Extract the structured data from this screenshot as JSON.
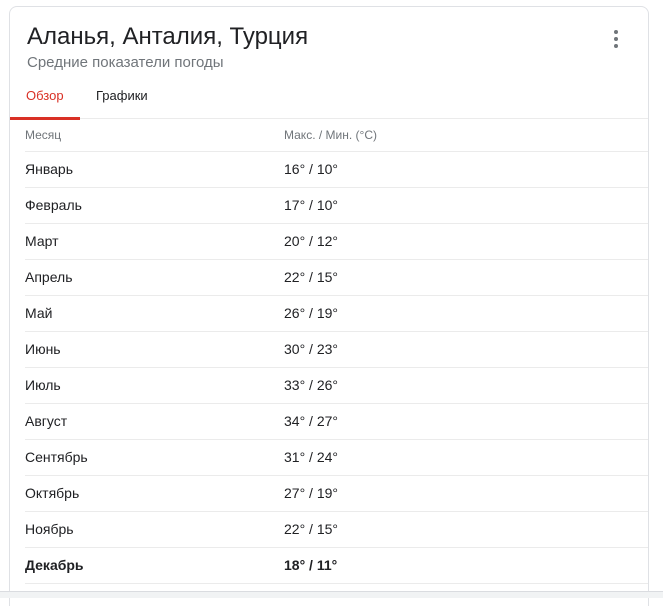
{
  "header": {
    "title": "Аланья, Анталия, Турция",
    "subtitle": "Средние показатели погоды"
  },
  "tabs": [
    {
      "label": "Обзор",
      "active": true
    },
    {
      "label": "Графики",
      "active": false
    }
  ],
  "table": {
    "columns": [
      "Месяц",
      "Макс. / Мин. (°C)"
    ],
    "rows": [
      {
        "month": "Январь",
        "temp": "16° / 10°"
      },
      {
        "month": "Февраль",
        "temp": "17° / 10°"
      },
      {
        "month": "Март",
        "temp": "20° / 12°"
      },
      {
        "month": "Апрель",
        "temp": "22° / 15°"
      },
      {
        "month": "Май",
        "temp": "26° / 19°"
      },
      {
        "month": "Июнь",
        "temp": "30° / 23°"
      },
      {
        "month": "Июль",
        "temp": "33° / 26°"
      },
      {
        "month": "Август",
        "temp": "34° / 27°"
      },
      {
        "month": "Сентябрь",
        "temp": "31° / 24°"
      },
      {
        "month": "Октябрь",
        "temp": "27° / 19°"
      },
      {
        "month": "Ноябрь",
        "temp": "22° / 15°"
      },
      {
        "month": "Декабрь",
        "temp": "18° / 11°",
        "highlight": true
      }
    ]
  },
  "colors": {
    "accent": "#d93025",
    "text": "#202124",
    "muted": "#70757a",
    "divider": "#ebebeb"
  },
  "icons": {
    "more": "more-vert-icon"
  }
}
